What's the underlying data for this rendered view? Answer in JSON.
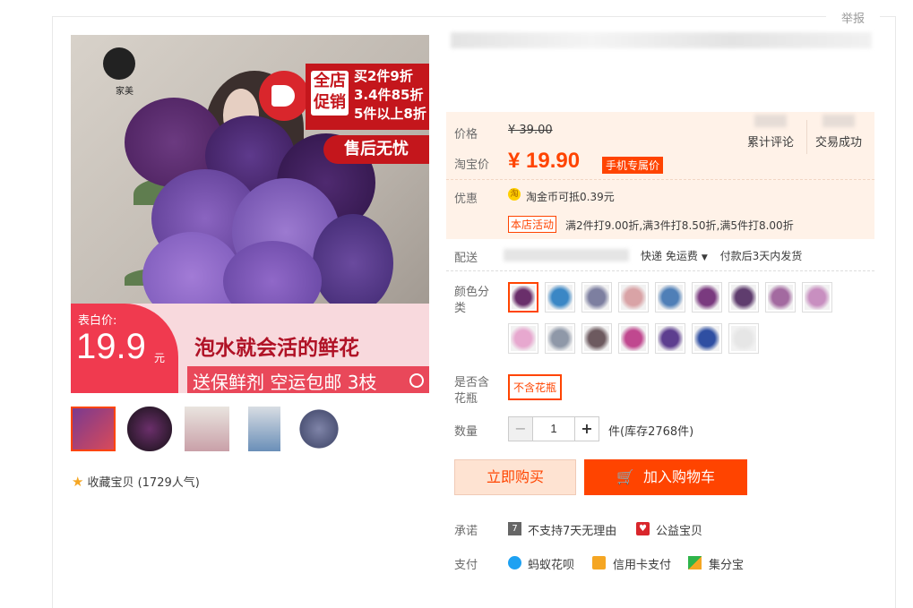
{
  "report": "举报",
  "main_image": {
    "logo_text": "家美",
    "promo_tag": "全店\n促销",
    "promo_lines": "买2件9折\n3.4件85折\n5件以上8折",
    "after_sale": "售后无忧",
    "price_label": "表白价:",
    "price": "19.9",
    "price_unit": "元",
    "slogan1": "泡水就会活的鲜花",
    "slogan2": "送保鲜剂 空运包邮 3枝"
  },
  "favorite": "收藏宝贝 (1729人气)",
  "price_panel": {
    "price_label": "价格",
    "original_price": "¥ 39.00",
    "tb_label": "淘宝价",
    "tb_price": "¥ 19.90",
    "mobile_tag": "手机专属价",
    "reviews_label": "累计评论",
    "deals_label": "交易成功",
    "promo_label": "优惠",
    "coin_icon": "淘",
    "coin_text": "淘金币可抵0.39元",
    "shop_tag": "本店活动",
    "shop_text": "满2件打9.00折,满3件打8.50折,满5件打8.00折"
  },
  "shipping": {
    "label": "配送",
    "method": "快递 免运费",
    "dispatch": "付款后3天内发货"
  },
  "color": {
    "label": "颜色分类",
    "swatches": [
      "#6a2f6b",
      "#3b87c5",
      "#7d7fa0",
      "#d9a3a6",
      "#4f7fb7",
      "#7a3a7f",
      "#5f3d6e",
      "#a36aa0",
      "#c88fc0",
      "#e7a8cf",
      "#8f98a8",
      "#6d5a5f",
      "#c0488f",
      "#5d3e8f",
      "#2f4fa2",
      "#e6e6e6"
    ],
    "selected_index": 0
  },
  "vase": {
    "label": "是否含花瓶",
    "option": "不含花瓶"
  },
  "quantity": {
    "label": "数量",
    "minus": "−",
    "value": "1",
    "plus": "+",
    "stock": "件(库存2768件)"
  },
  "buttons": {
    "buy": "立即购买",
    "cart": "加入购物车",
    "cart_icon": "🛒"
  },
  "promise": {
    "label": "承诺",
    "item1_icon": "7",
    "item1": "不支持7天无理由",
    "item2": "公益宝贝"
  },
  "payment": {
    "label": "支付",
    "item1": "蚂蚁花呗",
    "item2": "信用卡支付",
    "item3": "集分宝"
  }
}
